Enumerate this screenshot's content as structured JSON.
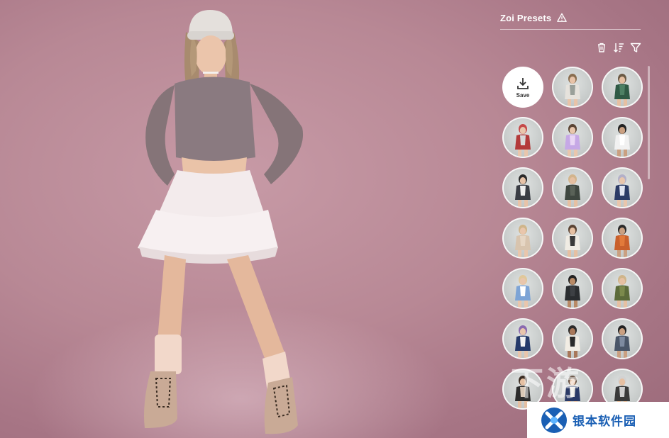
{
  "panel": {
    "title": "Zoi Presets",
    "save_label": "Save",
    "presets": [
      {
        "outfit": "#e6e2dc",
        "top": "#9aa09a",
        "hair": "#8a6e50",
        "skin": "#e8c3a8"
      },
      {
        "outfit": "#2f5a45",
        "top": "#4d8064",
        "hair": "#6b5a45",
        "skin": "#e6c0a2"
      },
      {
        "outfit": "#b33a3a",
        "top": "#d8d8d8",
        "hair": "#c54a4a",
        "skin": "#e9c6ac"
      },
      {
        "outfit": "#c6a8e6",
        "top": "#e9d6f4",
        "hair": "#5a4434",
        "skin": "#e9c6ac"
      },
      {
        "outfit": "#f1f1f1",
        "top": "#ffffff",
        "hair": "#222222",
        "skin": "#caa081"
      },
      {
        "outfit": "#3a3d44",
        "top": "#eeeeee",
        "hair": "#2a2a2a",
        "skin": "#e8c3a8"
      },
      {
        "outfit": "#3f4740",
        "top": "#5a6258",
        "hair": "#d2b48c",
        "skin": "#e6c0a2"
      },
      {
        "outfit": "#2b3b66",
        "top": "#e0e4f0",
        "hair": "#b3b0c8",
        "skin": "#e9c6ac"
      },
      {
        "outfit": "#d8c4ae",
        "top": "#e6d6c4",
        "hair": "#cfb58a",
        "skin": "#e9c6ac"
      },
      {
        "outfit": "#f0ece4",
        "top": "#3a3a3a",
        "hair": "#5a4434",
        "skin": "#e6c0a2"
      },
      {
        "outfit": "#c9602c",
        "top": "#e27a3a",
        "hair": "#2a2a2a",
        "skin": "#caa081"
      },
      {
        "outfit": "#7da4d6",
        "top": "#ffffff",
        "hair": "#e0c89a",
        "skin": "#e9c6ac"
      },
      {
        "outfit": "#2a2d30",
        "top": "#3d4044",
        "hair": "#222222",
        "skin": "#b88a66"
      },
      {
        "outfit": "#5c6b3a",
        "top": "#7c8a4c",
        "hair": "#cfb58a",
        "skin": "#e6c0a2"
      },
      {
        "outfit": "#253a6a",
        "top": "#f2f2f2",
        "hair": "#8a6ab0",
        "skin": "#e9c6ac"
      },
      {
        "outfit": "#f2ede4",
        "top": "#2a2a2a",
        "hair": "#2a2a2a",
        "skin": "#a8785a"
      },
      {
        "outfit": "#4a5668",
        "top": "#7e8ba0",
        "hair": "#222222",
        "skin": "#caa081"
      },
      {
        "outfit": "#2c2c2c",
        "top": "#d9c8b6",
        "hair": "#3a2c22",
        "skin": "#e6c0a2"
      },
      {
        "outfit": "#2a3a66",
        "top": "#e9e6de",
        "hair": "#5a4434",
        "skin": "#e9c6ac"
      },
      {
        "outfit": "#3a3a3a",
        "top": "#cfcfcf",
        "hair": "#d2d2d2",
        "skin": "#e6c0a2"
      }
    ]
  },
  "watermark": {
    "text": "银本软件园",
    "faded": "下游"
  },
  "colors": {
    "watermark_blue": "#1a5fb4"
  }
}
